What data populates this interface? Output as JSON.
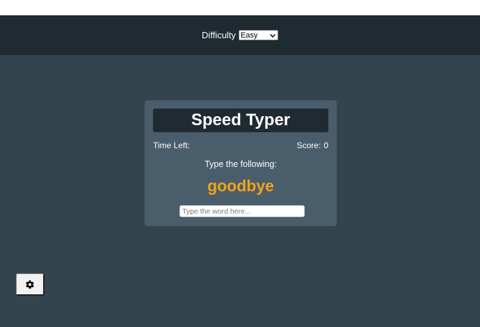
{
  "header": {
    "difficulty_label": "Difficulty",
    "difficulty_selected": "Easy"
  },
  "game": {
    "title": "Speed Typer",
    "time_label": "Time Left:",
    "time_value": "",
    "score_label": "Score:",
    "score_value": "0",
    "instruction": "Type the following:",
    "word": "goodbye",
    "input_placeholder": "Type the word here...",
    "input_value": ""
  },
  "settings": {
    "icon": "gear-icon"
  },
  "colors": {
    "app_background": "#34444f",
    "header_background": "#1f2a31",
    "card_background": "#4a5d6a",
    "word_color": "#f0a31a"
  }
}
